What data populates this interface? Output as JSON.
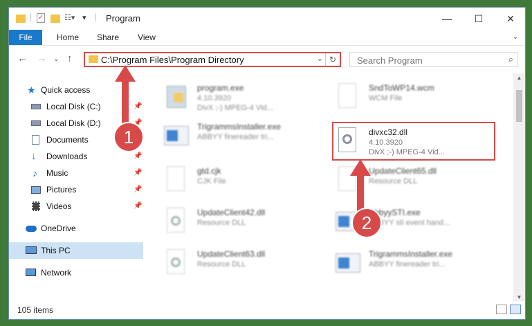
{
  "window": {
    "title": "Program",
    "controls": {
      "minimize": "—",
      "maximize": "☐",
      "close": "✕"
    }
  },
  "ribbon": {
    "tabs": [
      "File",
      "Home",
      "Share",
      "View"
    ]
  },
  "address": {
    "path": "C:\\Program Files\\Program Directory",
    "search_placeholder": "Search Program"
  },
  "nav": {
    "items": [
      {
        "label": "Quick access",
        "icon": "star-icon",
        "pinned": false
      },
      {
        "label": "Local Disk (C:)",
        "icon": "drive-icon",
        "pinned": true
      },
      {
        "label": "Local Disk (D:)",
        "icon": "drive-icon",
        "pinned": true
      },
      {
        "label": "Documents",
        "icon": "document-icon",
        "pinned": true
      },
      {
        "label": "Downloads",
        "icon": "download-icon",
        "pinned": true
      },
      {
        "label": "Music",
        "icon": "music-icon",
        "pinned": true
      },
      {
        "label": "Pictures",
        "icon": "picture-icon",
        "pinned": true
      },
      {
        "label": "Videos",
        "icon": "video-icon",
        "pinned": true
      },
      {
        "label": "OneDrive",
        "icon": "cloud-icon",
        "pinned": false
      },
      {
        "label": "This PC",
        "icon": "computer-icon",
        "pinned": false
      },
      {
        "label": "Network",
        "icon": "network-icon",
        "pinned": false
      }
    ]
  },
  "files": [
    {
      "name": "program.exe",
      "meta1": "4.10.3920",
      "meta2": "DivX ;-) MPEG-4 Vid...",
      "icon": "exe-icon"
    },
    {
      "name": "SndToWP14.wcm",
      "meta1": "WCM File",
      "meta2": "",
      "icon": "file-icon"
    },
    {
      "name": "TrigrammsInstaller.exe",
      "meta1": "ABBYY finereader tri...",
      "meta2": "",
      "icon": "exe-icon"
    },
    {
      "name": "divxc32.dll",
      "meta1": "4.10.3920",
      "meta2": "DivX ;-) MPEG-4 Vid...",
      "icon": "dll-icon"
    },
    {
      "name": "gtd.cjk",
      "meta1": "CJK File",
      "meta2": "",
      "icon": "file-icon"
    },
    {
      "name": "UpdateClient65.dll",
      "meta1": "Resource DLL",
      "meta2": "",
      "icon": "dll-icon"
    },
    {
      "name": "UpdateClient42.dll",
      "meta1": "Resource DLL",
      "meta2": "",
      "icon": "dll-icon"
    },
    {
      "name": "AbbyySTI.exe",
      "meta1": "ABBYY sti event hand...",
      "meta2": "",
      "icon": "exe-icon"
    },
    {
      "name": "UpdateClient63.dll",
      "meta1": "Resource DLL",
      "meta2": "",
      "icon": "dll-icon"
    },
    {
      "name": "TrigrammsInstaller.exe",
      "meta1": "ABBYY finereader tri...",
      "meta2": "",
      "icon": "exe-icon"
    }
  ],
  "status": {
    "count": "105 items"
  },
  "callouts": [
    "1",
    "2"
  ],
  "colors": {
    "accent": "#1979ca",
    "highlight": "#d84a4a",
    "selected": "#cde3f5"
  }
}
